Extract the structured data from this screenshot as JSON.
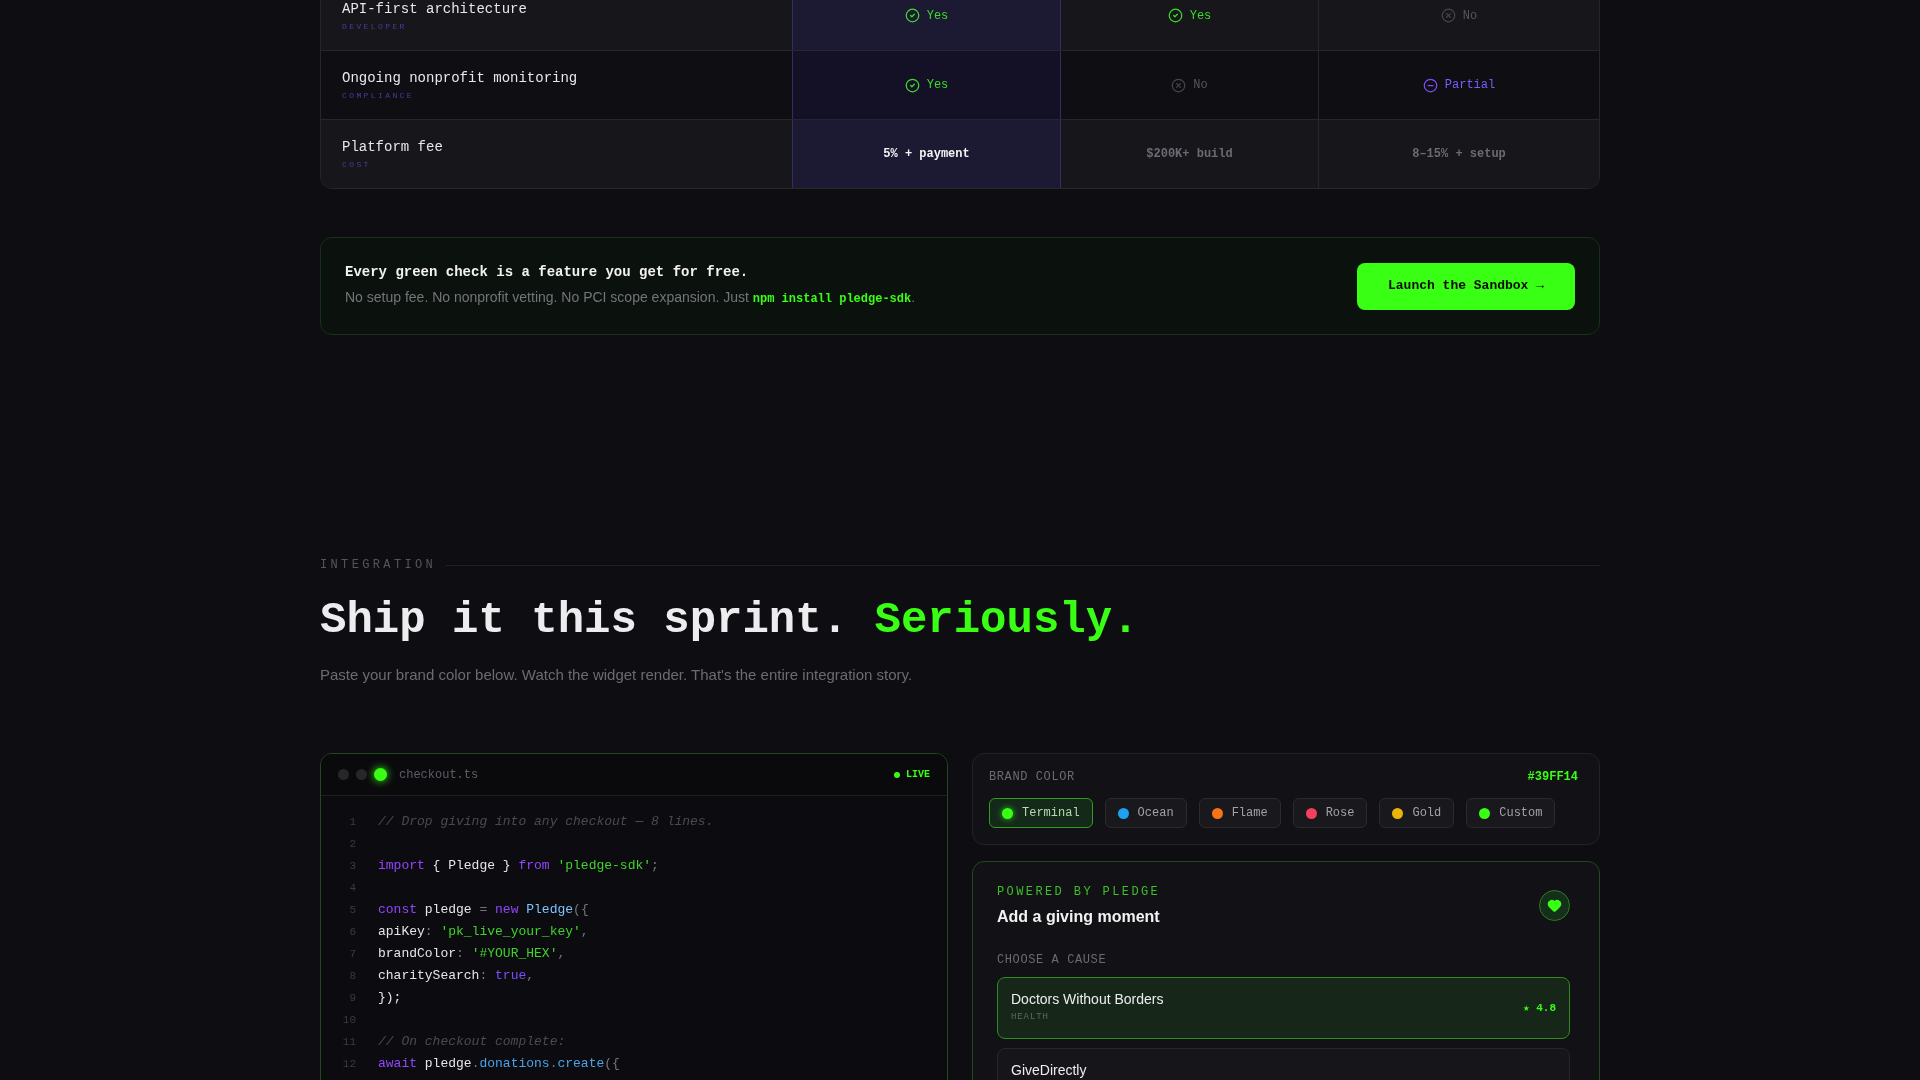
{
  "comparison_table": {
    "rows": [
      {
        "feature": "API-first architecture",
        "category": "DEVELOPER",
        "cells": [
          {
            "kind": "yes",
            "text": "Yes",
            "highlighted": true
          },
          {
            "kind": "yes",
            "text": "Yes",
            "highlighted": false
          },
          {
            "kind": "no",
            "text": "No",
            "highlighted": false
          }
        ]
      },
      {
        "feature": "Ongoing nonprofit monitoring",
        "category": "COMPLIANCE",
        "cells": [
          {
            "kind": "yes",
            "text": "Yes",
            "highlighted": true
          },
          {
            "kind": "no",
            "text": "No",
            "highlighted": false
          },
          {
            "kind": "partial",
            "text": "Partial",
            "highlighted": false
          }
        ]
      },
      {
        "feature": "Platform fee",
        "category": "COST",
        "cells": [
          {
            "kind": "value",
            "text": "5% + payment",
            "highlighted": true
          },
          {
            "kind": "value",
            "text": "$200K+ build",
            "highlighted": false
          },
          {
            "kind": "value",
            "text": "8–15% + setup",
            "highlighted": false
          }
        ]
      }
    ]
  },
  "cta": {
    "title": "Every green check is a feature you get for free.",
    "text": "No setup fee. No nonprofit vetting. No PCI scope expansion. Just ",
    "command": "npm install pledge-sdk",
    "text_end": ".",
    "button": "Launch the Sandbox →"
  },
  "integration": {
    "eyebrow": "INTEGRATION",
    "heading": "Ship it this sprint.",
    "heading_accent": "Seriously.",
    "subtitle": "Paste your brand color below. Watch the widget render. That's the entire integration story."
  },
  "code_editor": {
    "filename": "checkout.ts",
    "status": "LIVE",
    "lines": [
      {
        "number": "1",
        "tokens": [
          {
            "kind": "comment",
            "text": "// Drop giving into any checkout — 8 lines."
          }
        ]
      },
      {
        "number": "2"
      },
      {
        "number": "3",
        "tokens": [
          {
            "kind": "keyword",
            "text": "import"
          },
          {
            "kind": "plain",
            "text": " { Pledge } "
          },
          {
            "kind": "keyword",
            "text": "from"
          },
          {
            "kind": "string",
            "text": " 'pledge-sdk'"
          },
          {
            "kind": "punct",
            "text": ";"
          }
        ]
      },
      {
        "number": "4"
      },
      {
        "number": "5",
        "tokens": [
          {
            "kind": "keyword",
            "text": "const"
          },
          {
            "kind": "plain",
            "text": " pledge "
          },
          {
            "kind": "punct",
            "text": "="
          },
          {
            "kind": "keyword",
            "text": " new"
          },
          {
            "kind": "class",
            "text": " Pledge"
          },
          {
            "kind": "punct",
            "text": "({"
          }
        ]
      },
      {
        "number": "6",
        "tokens": [
          {
            "kind": "plain",
            "text": "apiKey"
          },
          {
            "kind": "punct",
            "text": ":"
          },
          {
            "kind": "string",
            "text": " 'pk_live_your_key'"
          },
          {
            "kind": "punct",
            "text": ","
          }
        ]
      },
      {
        "number": "7",
        "tokens": [
          {
            "kind": "plain",
            "text": "brandColor"
          },
          {
            "kind": "punct",
            "text": ":"
          },
          {
            "kind": "string",
            "text": " '#YOUR_HEX'"
          },
          {
            "kind": "punct",
            "text": ","
          }
        ]
      },
      {
        "number": "8",
        "tokens": [
          {
            "kind": "plain",
            "text": "charitySearch"
          },
          {
            "kind": "punct",
            "text": ":"
          },
          {
            "kind": "boolean",
            "text": " true"
          },
          {
            "kind": "punct",
            "text": ","
          }
        ]
      },
      {
        "number": "9",
        "tokens": [
          {
            "kind": "plain",
            "text": "});"
          }
        ]
      },
      {
        "number": "10"
      },
      {
        "number": "11",
        "tokens": [
          {
            "kind": "comment",
            "text": "// On checkout complete:"
          }
        ]
      },
      {
        "number": "12",
        "tokens": [
          {
            "kind": "keyword",
            "text": "await"
          },
          {
            "kind": "plain",
            "text": " pledge"
          },
          {
            "kind": "punct",
            "text": "."
          },
          {
            "kind": "method",
            "text": "donations"
          },
          {
            "kind": "punct",
            "text": "."
          },
          {
            "kind": "method",
            "text": "create"
          },
          {
            "kind": "punct",
            "text": "({"
          }
        ]
      }
    ]
  },
  "brand_color": {
    "label": "BRAND COLOR",
    "value": "#39FF14",
    "swatches": [
      {
        "name": "Terminal",
        "color": "#39ff14",
        "selected": true
      },
      {
        "name": "Ocean",
        "color": "#1da1f2",
        "selected": false
      },
      {
        "name": "Flame",
        "color": "#f97316",
        "selected": false
      },
      {
        "name": "Rose",
        "color": "#f43f5e",
        "selected": false
      },
      {
        "name": "Gold",
        "color": "#eab308",
        "selected": false
      },
      {
        "name": "Custom",
        "color": "#39ff14",
        "selected": false
      }
    ]
  },
  "widget": {
    "eyebrow": "POWERED BY PLEDGE",
    "title": "Add a giving moment",
    "section_label": "CHOOSE A CAUSE",
    "causes": [
      {
        "name": "Doctors Without Borders",
        "category": "HEALTH",
        "rating": "★ 4.8",
        "selected": true
      },
      {
        "name": "GiveDirectly",
        "selected": false
      }
    ]
  }
}
